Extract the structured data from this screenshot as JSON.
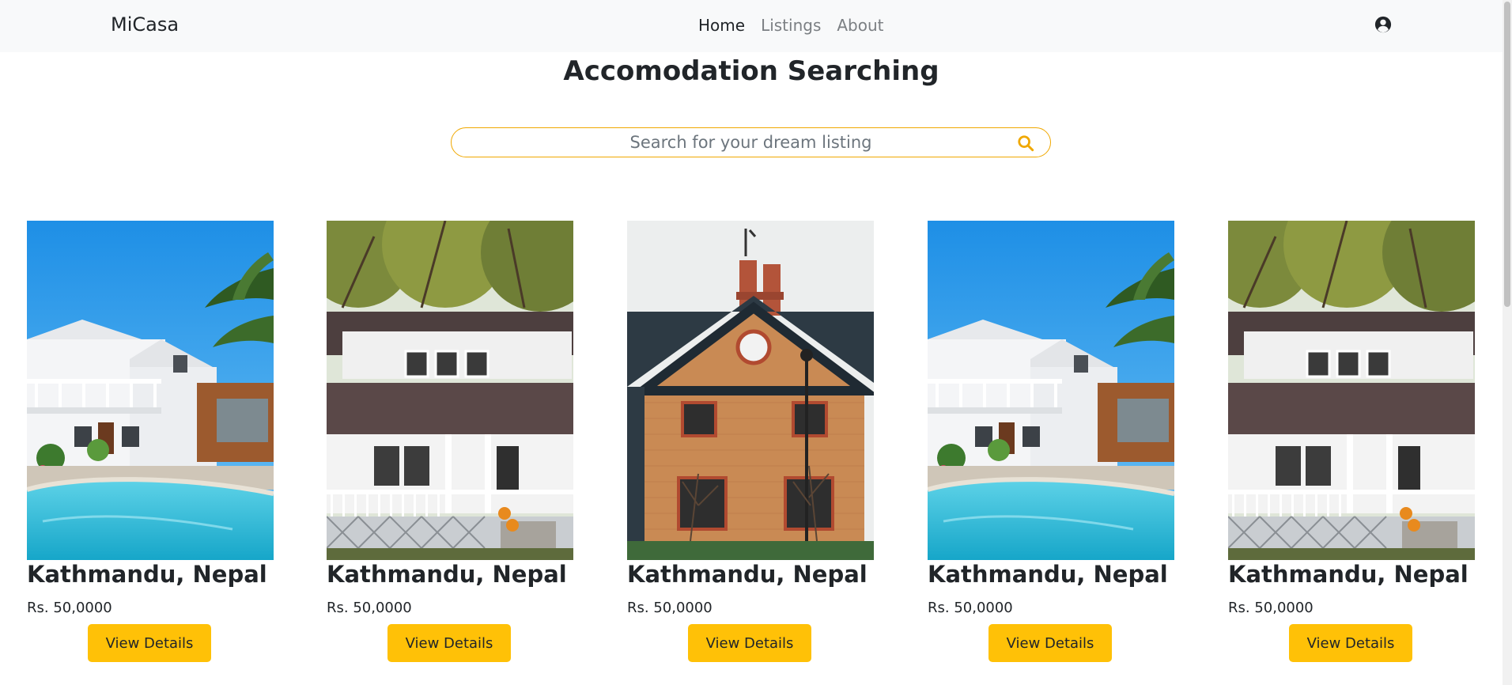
{
  "navbar": {
    "brand": "MiCasa",
    "links": [
      {
        "label": "Home",
        "active": true
      },
      {
        "label": "Listings",
        "active": false
      },
      {
        "label": "About",
        "active": false
      }
    ],
    "user_icon": "user-circle-icon"
  },
  "page_title": "Accomodation Searching",
  "search": {
    "placeholder": "Search for your dream listing",
    "value": "",
    "icon": "search-icon",
    "accent_color": "#f0a800"
  },
  "listings": [
    {
      "image": "white-house-pool",
      "title": "Kathmandu, Nepal",
      "price": "Rs. 50,0000",
      "button": "View Details"
    },
    {
      "image": "white-house-porch",
      "title": "Kathmandu, Nepal",
      "price": "Rs. 50,0000",
      "button": "View Details"
    },
    {
      "image": "brick-house",
      "title": "Kathmandu, Nepal",
      "price": "Rs. 50,0000",
      "button": "View Details"
    },
    {
      "image": "white-house-pool",
      "title": "Kathmandu, Nepal",
      "price": "Rs. 50,0000",
      "button": "View Details"
    },
    {
      "image": "white-house-porch",
      "title": "Kathmandu, Nepal",
      "price": "Rs. 50,0000",
      "button": "View Details"
    }
  ],
  "colors": {
    "button": "#ffc107",
    "navbar_bg": "#f8f9fa",
    "text": "#212529",
    "muted": "#7b7f83"
  }
}
